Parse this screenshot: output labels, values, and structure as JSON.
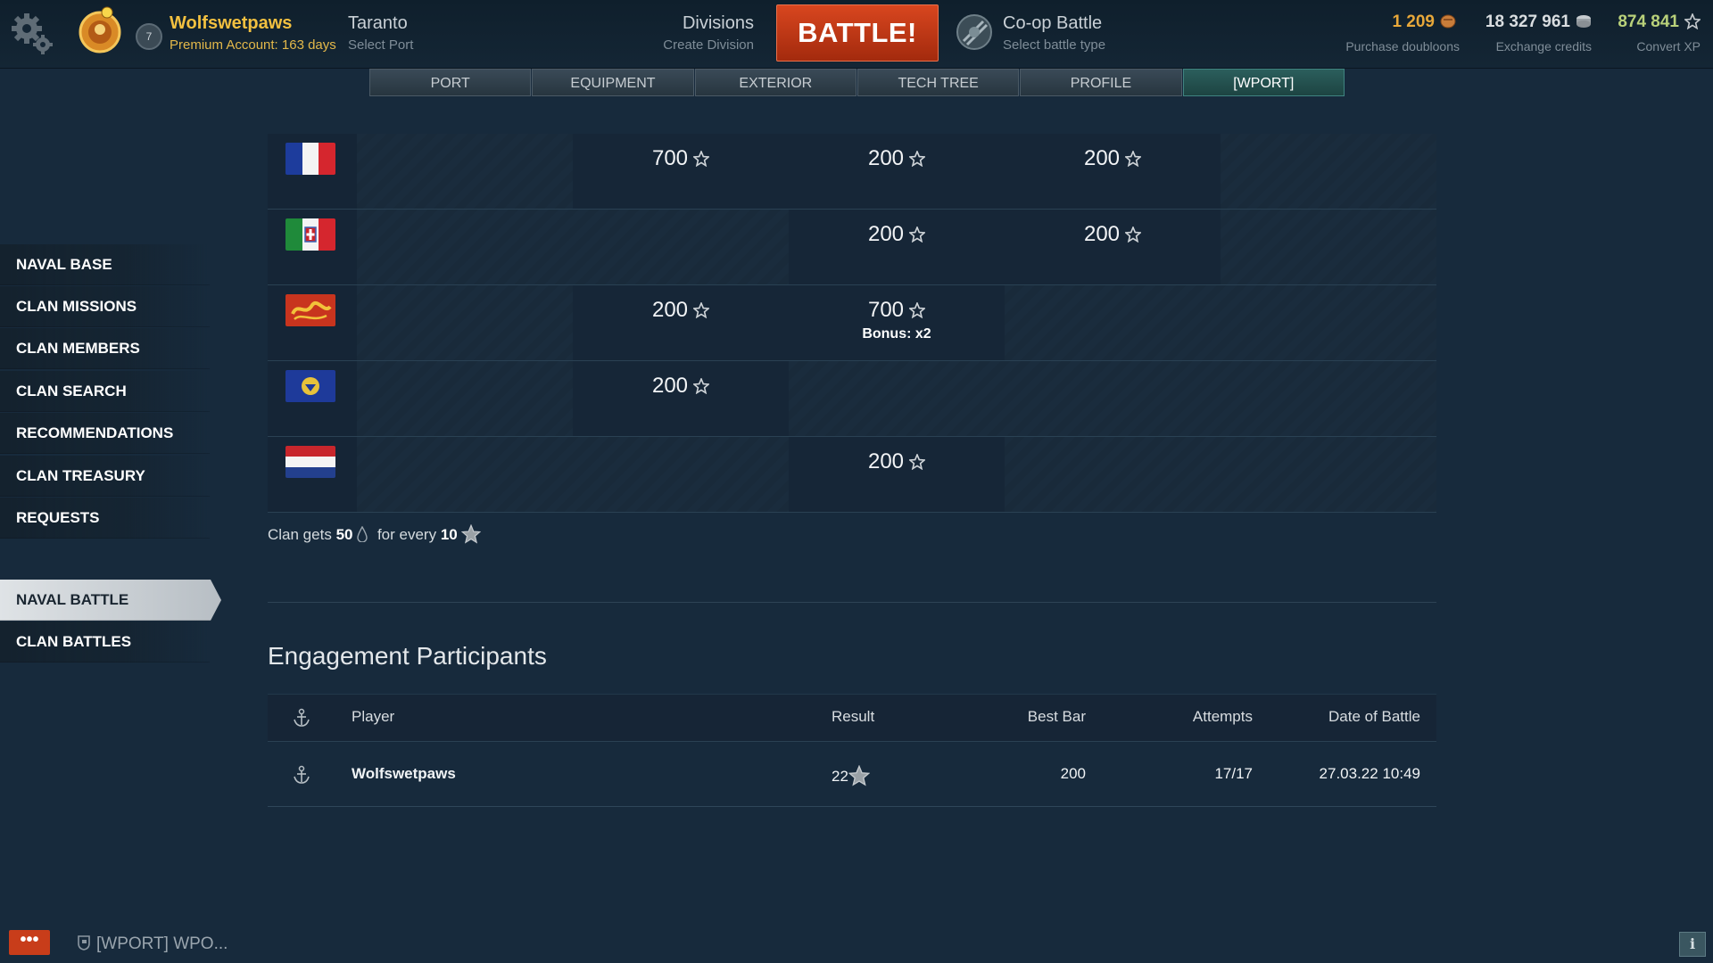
{
  "account": {
    "name": "Wolfswetpaws",
    "premium": "Premium Account: 163 days",
    "level": "7"
  },
  "port": {
    "name": "Taranto",
    "sub": "Select Port"
  },
  "divisions": {
    "name": "Divisions",
    "sub": "Create Division"
  },
  "battle_label": "BATTLE!",
  "battle_type": {
    "name": "Co-op Battle",
    "sub": "Select battle type"
  },
  "currencies": [
    {
      "value": "1 209",
      "label": "Purchase doubloons",
      "color": "#e8a83a",
      "icon": "doubloon-icon"
    },
    {
      "value": "18 327 961",
      "label": "Exchange credits",
      "color": "#d9dde0",
      "icon": "credits-icon"
    },
    {
      "value": "874 841",
      "label": "Convert XP",
      "color": "#b9d17a",
      "icon": "xp-star-icon"
    }
  ],
  "tabs": [
    "PORT",
    "EQUIPMENT",
    "EXTERIOR",
    "TECH TREE",
    "PROFILE",
    "[WPORT]"
  ],
  "active_tab": "[WPORT]",
  "sidebar": {
    "items": [
      "NAVAL BASE",
      "CLAN MISSIONS",
      "CLAN MEMBERS",
      "CLAN SEARCH",
      "RECOMMENDATIONS",
      "CLAN TREASURY",
      "REQUESTS"
    ],
    "battle_items": [
      "NAVAL BATTLE",
      "CLAN BATTLES"
    ],
    "active": "NAVAL BATTLE"
  },
  "grid": {
    "rows": [
      {
        "flag": "france-flag",
        "cells": [
          "",
          "700",
          "200",
          "200",
          "",
          ""
        ]
      },
      {
        "flag": "italy-flag",
        "cells": [
          "",
          "",
          "200",
          "200",
          "",
          ""
        ]
      },
      {
        "flag": "pan-asia-flag",
        "cells": [
          "",
          "200",
          "700",
          "",
          "",
          ""
        ]
      },
      {
        "flag": "pan-europe-flag",
        "cells": [
          "",
          "200",
          "",
          "",
          "",
          ""
        ]
      },
      {
        "flag": "netherlands-flag",
        "cells": [
          "",
          "",
          "200",
          "",
          "",
          ""
        ]
      }
    ],
    "bonus": {
      "row": 2,
      "col": 2,
      "text": "Bonus: x2"
    }
  },
  "clan_gets": {
    "prefix": "Clan gets",
    "amount": "50",
    "middle": "for every",
    "per": "10"
  },
  "engagement_title": "Engagement Participants",
  "participants": {
    "headers": {
      "player": "Player",
      "result": "Result",
      "best_bar": "Best Bar",
      "attempts": "Attempts",
      "date": "Date of Battle"
    },
    "rows": [
      {
        "player": "Wolfswetpaws",
        "result": "22",
        "best_bar": "200",
        "attempts": "17/17",
        "date": "27.03.22 10:49"
      }
    ]
  },
  "chat": {
    "channel": "[WPORT] WPO..."
  }
}
